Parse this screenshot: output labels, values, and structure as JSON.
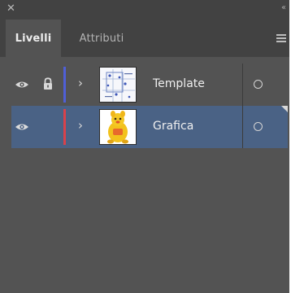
{
  "window": {
    "close_glyph": "✕",
    "collapse_glyph": "‹‹"
  },
  "tabs": [
    {
      "label": "Livelli",
      "active": true
    },
    {
      "label": "Attributi",
      "active": false
    }
  ],
  "panel_menu_icon": "hamburger-menu-icon",
  "layers": [
    {
      "name": "Template",
      "visible": true,
      "locked": true,
      "expanded": false,
      "color": "#4f5fd6",
      "selected": false,
      "thumbnail": "template-thumbnail"
    },
    {
      "name": "Grafica",
      "visible": true,
      "locked": false,
      "expanded": false,
      "color": "#d8424b",
      "selected": true,
      "thumbnail": "grafica-thumbnail"
    }
  ],
  "colors": {
    "panel_bg": "#535353",
    "header_bg": "#424242",
    "selection_bg": "#4a6285"
  }
}
